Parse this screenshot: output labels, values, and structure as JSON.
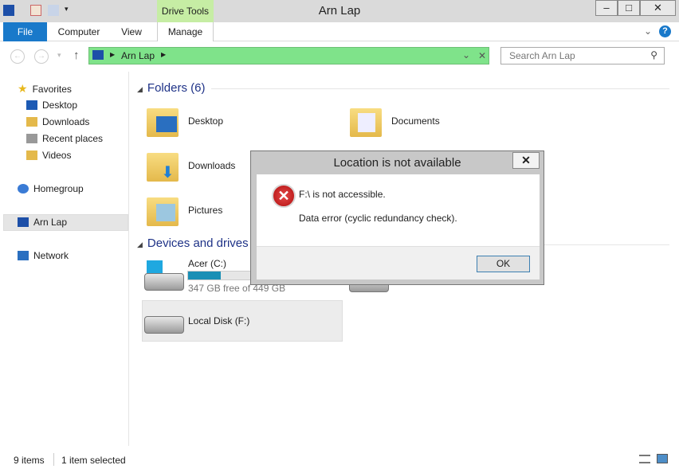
{
  "window": {
    "title": "Arn Lap",
    "controls": [
      "–",
      "□",
      "✕"
    ]
  },
  "ribbon": {
    "contextual": "Drive Tools",
    "tabs": [
      "File",
      "Computer",
      "View",
      "Manage"
    ]
  },
  "address": {
    "path": "Arn Lap",
    "search_placeholder": "Search Arn Lap"
  },
  "sidebar": {
    "favorites": "Favorites",
    "fav_items": [
      "Desktop",
      "Downloads",
      "Recent places",
      "Videos"
    ],
    "homegroup": "Homegroup",
    "computer": "Arn Lap",
    "network": "Network"
  },
  "folders": {
    "header": "Folders (6)",
    "items": [
      "Desktop",
      "Documents",
      "Downloads",
      "Pictures"
    ]
  },
  "drives": {
    "header": "Devices and drives",
    "c_name": "Acer (C:)",
    "c_free": "347 GB free of 449 GB",
    "c_used_fraction": 0.23,
    "f_name": "Local Disk (F:)"
  },
  "status": {
    "count": "9 items",
    "selected": "1 item selected"
  },
  "dialog": {
    "title": "Location is not available",
    "line1": "F:\\ is not accessible.",
    "line2": "Data error (cyclic redundancy check).",
    "ok": "OK",
    "close": "✕"
  },
  "colors": {
    "file_tab": "#1979ca",
    "address": "#7fe38a",
    "drive_bar": "#1a8fb5",
    "error": "#c41a1a"
  }
}
